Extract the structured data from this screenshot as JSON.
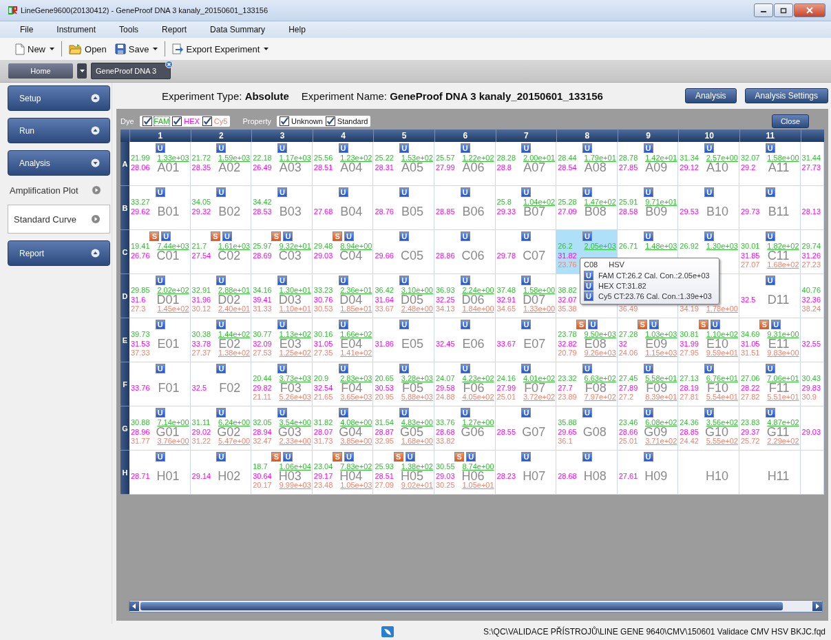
{
  "window": {
    "title": "LineGene9600(20130412) - GeneProof DNA 3 kanaly_20150601_133156"
  },
  "menu": [
    "File",
    "Instrument",
    "Tools",
    "Report",
    "Data Summary",
    "Help"
  ],
  "toolbar": [
    {
      "label": "New",
      "dropdown": true
    },
    {
      "label": "Open",
      "dropdown": false
    },
    {
      "label": "Save",
      "dropdown": true
    },
    {
      "label": "Export Experiment",
      "dropdown": true
    }
  ],
  "tabs": [
    {
      "label": "Home",
      "selected": false
    },
    {
      "label": "GeneProof DNA 3",
      "selected": true
    }
  ],
  "sidebar": [
    {
      "label": "Setup",
      "expanded": false
    },
    {
      "label": "Run",
      "expanded": false
    },
    {
      "label": "Analysis",
      "expanded": true,
      "items": [
        {
          "label": "Amplification Plot",
          "selected": false
        },
        {
          "label": "Standard Curve",
          "selected": true
        }
      ]
    },
    {
      "label": "Report",
      "expanded": false
    }
  ],
  "header": {
    "experiment_type": "Experiment Type: **Absolute**",
    "experiment_name": "Experiment Name: **GeneProof DNA 3 kanaly_20150601_133156**",
    "buttons": [
      "Analysis",
      "Analysis Settings"
    ]
  },
  "filters": {
    "dye_label": "Dye",
    "dyes": [
      {
        "label": "FAM",
        "checked": true,
        "color": "#22b022"
      },
      {
        "label": "HEX",
        "checked": true,
        "color": "#ff00ff"
      },
      {
        "label": "Cy5",
        "checked": true,
        "color": "#f4826c"
      }
    ],
    "property_label": "Property",
    "properties": [
      {
        "label": "Unknown",
        "checked": true
      },
      {
        "label": "Standard",
        "checked": true
      }
    ],
    "close": "Close"
  },
  "plate": {
    "columns": [
      "1",
      "2",
      "3",
      "4",
      "5",
      "6",
      "7",
      "8",
      "9",
      "10",
      "11"
    ],
    "rows": [
      {
        "label": "A",
        "cells": [
          {
            "well": "A01",
            "selected": false,
            "tags": [
              {
                "kind": "unknown",
                "text": "U"
              }
            ],
            "fam": [
              "21.99",
              "1.33e+03"
            ],
            "hex": "28.06"
          },
          {
            "well": "A02",
            "selected": false,
            "tags": [
              {
                "kind": "unknown",
                "text": "U"
              }
            ],
            "fam": [
              "21.72",
              "1.59e+03"
            ],
            "hex": "28.35"
          },
          {
            "well": "A03",
            "selected": false,
            "tags": [
              {
                "kind": "unknown",
                "text": "U"
              }
            ],
            "fam": [
              "22.18",
              "1.17e+03"
            ],
            "hex": "26.49"
          },
          {
            "well": "A04",
            "selected": false,
            "tags": [
              {
                "kind": "unknown",
                "text": "U"
              }
            ],
            "fam": [
              "25.56",
              "1.23e+02"
            ],
            "hex": "28.51"
          },
          {
            "well": "A05",
            "selected": false,
            "tags": [
              {
                "kind": "unknown",
                "text": "U"
              }
            ],
            "fam": [
              "25.22",
              "1.53e+02"
            ],
            "hex": "28.31"
          },
          {
            "well": "A06",
            "selected": false,
            "tags": [
              {
                "kind": "unknown",
                "text": "U"
              }
            ],
            "fam": [
              "25.57",
              "1.22e+02"
            ],
            "hex": "27.99"
          },
          {
            "well": "A07",
            "selected": false,
            "tags": [
              {
                "kind": "unknown",
                "text": "U"
              }
            ],
            "fam": [
              "28.28",
              "2.00e+01"
            ],
            "hex": "28.8"
          },
          {
            "well": "A08",
            "selected": false,
            "tags": [
              {
                "kind": "unknown",
                "text": "U"
              }
            ],
            "fam": [
              "28.44",
              "1.79e+01"
            ],
            "hex": "28.54"
          },
          {
            "well": "A09",
            "selected": false,
            "tags": [
              {
                "kind": "unknown",
                "text": "U"
              }
            ],
            "fam": [
              "28.78",
              "1.42e+01"
            ],
            "hex": "27.85"
          },
          {
            "well": "A10",
            "selected": false,
            "tags": [
              {
                "kind": "unknown",
                "text": "U"
              }
            ],
            "fam": [
              "31.34",
              "2.57e+00"
            ],
            "hex": "29.12"
          },
          {
            "well": "A11",
            "selected": false,
            "tags": [
              {
                "kind": "unknown",
                "text": "U"
              }
            ],
            "fam": [
              "32.07",
              "1.58e+00"
            ],
            "hex": "29.2"
          },
          {
            "selected": false,
            "fam": [
              "31.44"
            ],
            "hex": "27.73"
          }
        ]
      },
      {
        "label": "B",
        "cells": [
          {
            "well": "B01",
            "selected": false,
            "tags": [
              {
                "kind": "unknown",
                "text": "U"
              }
            ],
            "fam": [
              "33.27"
            ],
            "hex": "29.62"
          },
          {
            "well": "B02",
            "selected": false,
            "tags": [
              {
                "kind": "unknown",
                "text": "U"
              }
            ],
            "fam": [
              "34.05"
            ],
            "hex": "29.32"
          },
          {
            "well": "B03",
            "selected": false,
            "tags": [
              {
                "kind": "unknown",
                "text": "U"
              }
            ],
            "fam": [
              "34.42"
            ],
            "hex": "28.53"
          },
          {
            "well": "B04",
            "selected": false,
            "tags": [
              {
                "kind": "unknown",
                "text": "U"
              }
            ],
            "hex": "27.68"
          },
          {
            "well": "B05",
            "selected": false,
            "tags": [
              {
                "kind": "unknown",
                "text": "U"
              }
            ],
            "hex": "28.76"
          },
          {
            "well": "B06",
            "selected": false,
            "tags": [
              {
                "kind": "unknown",
                "text": "U"
              }
            ],
            "hex": "28.85"
          },
          {
            "well": "B07",
            "selected": false,
            "tags": [
              {
                "kind": "unknown",
                "text": "U"
              }
            ],
            "fam": [
              "25.8",
              "1.04e+02"
            ],
            "hex": "29.33"
          },
          {
            "well": "B08",
            "selected": false,
            "tags": [
              {
                "kind": "unknown",
                "text": "U"
              }
            ],
            "fam": [
              "25.28",
              "1.47e+02"
            ],
            "hex": "27.09"
          },
          {
            "well": "B09",
            "selected": false,
            "tags": [
              {
                "kind": "unknown",
                "text": "U"
              }
            ],
            "fam": [
              "25.91",
              "9.71e+01"
            ],
            "hex": "28.58"
          },
          {
            "well": "B10",
            "selected": false,
            "tags": [
              {
                "kind": "unknown",
                "text": "U"
              }
            ],
            "hex": "29.53"
          },
          {
            "well": "B11",
            "selected": false,
            "tags": [
              {
                "kind": "unknown",
                "text": "U"
              }
            ],
            "hex": "29.73"
          },
          {
            "selected": false,
            "hex": "28.13"
          }
        ]
      },
      {
        "label": "C",
        "cells": [
          {
            "well": "C01",
            "selected": false,
            "tags": [
              {
                "kind": "standard",
                "text": "S"
              },
              {
                "kind": "unknown",
                "text": "U"
              }
            ],
            "fam": [
              "19.41",
              "7.44e+03"
            ],
            "hex": "26.76"
          },
          {
            "well": "C02",
            "selected": false,
            "tags": [
              {
                "kind": "standard",
                "text": "S"
              },
              {
                "kind": "unknown",
                "text": "U"
              }
            ],
            "fam": [
              "21.7",
              "1.61e+03"
            ],
            "hex": "27.54"
          },
          {
            "well": "C03",
            "selected": false,
            "tags": [
              {
                "kind": "standard",
                "text": "S"
              },
              {
                "kind": "unknown",
                "text": "U"
              }
            ],
            "fam": [
              "25.97",
              "9.32e+01"
            ],
            "hex": "28.69"
          },
          {
            "well": "C04",
            "selected": false,
            "tags": [
              {
                "kind": "standard",
                "text": "S"
              },
              {
                "kind": "unknown",
                "text": "U"
              }
            ],
            "fam": [
              "29.48",
              "8.94e+00"
            ],
            "hex": "29.03"
          },
          {
            "well": "C05",
            "selected": false,
            "tags": [
              {
                "kind": "unknown",
                "text": "U"
              }
            ],
            "hex": "29.66"
          },
          {
            "well": "C06",
            "selected": false,
            "tags": [
              {
                "kind": "unknown",
                "text": "U"
              }
            ],
            "hex": "28.86"
          },
          {
            "well": "C07",
            "selected": false,
            "tags": [
              {
                "kind": "unknown",
                "text": "U"
              }
            ],
            "hex": "29.78"
          },
          {
            "selected": true,
            "tags": [
              {
                "kind": "unknown",
                "text": "U"
              }
            ],
            "fam": [
              "26.2",
              "2.05e+03"
            ],
            "hex": "31.82",
            "cy5": [
              "23.76"
            ]
          },
          {
            "selected": false,
            "tags": [
              {
                "kind": "unknown",
                "text": "U"
              }
            ],
            "fam": [
              "26.71",
              "1.48e+03"
            ]
          },
          {
            "selected": false,
            "tags": [
              {
                "kind": "unknown",
                "text": "U"
              }
            ],
            "fam": [
              "26.92",
              "1.30e+03"
            ]
          },
          {
            "well": "C11",
            "selected": false,
            "tags": [
              {
                "kind": "unknown",
                "text": "U"
              }
            ],
            "fam": [
              "30.01",
              "1.82e+02"
            ],
            "hex": "31.85",
            "cy5": [
              "27.07",
              "1.68e+02"
            ]
          },
          {
            "selected": false,
            "fam": [
              "29.74"
            ],
            "hex": "31.26",
            "cy5": [
              "27.23"
            ]
          }
        ]
      },
      {
        "label": "D",
        "cells": [
          {
            "well": "D01",
            "selected": false,
            "tags": [
              {
                "kind": "unknown",
                "text": "U"
              }
            ],
            "fam": [
              "29.85",
              "2.02e+02"
            ],
            "hex": "31.6",
            "cy5": [
              "27.3",
              "1.45e+02"
            ]
          },
          {
            "well": "D02",
            "selected": false,
            "tags": [
              {
                "kind": "unknown",
                "text": "U"
              }
            ],
            "fam": [
              "32.91",
              "2.88e+01"
            ],
            "hex": "31.96",
            "cy5": [
              "30.12",
              "2.40e+01"
            ]
          },
          {
            "well": "D03",
            "selected": false,
            "tags": [
              {
                "kind": "unknown",
                "text": "U"
              }
            ],
            "fam": [
              "34.16",
              "1.30e+01"
            ],
            "hex": "39.41",
            "cy5": [
              "31.33",
              "1.10e+01"
            ]
          },
          {
            "well": "D04",
            "selected": false,
            "tags": [
              {
                "kind": "unknown",
                "text": "U"
              }
            ],
            "fam": [
              "33.23",
              "2.36e+01"
            ],
            "hex": "30.76",
            "cy5": [
              "30.53",
              "1.85e+01"
            ]
          },
          {
            "well": "D05",
            "selected": false,
            "tags": [
              {
                "kind": "unknown",
                "text": "U"
              }
            ],
            "fam": [
              "36.42",
              "3.10e+00"
            ],
            "hex": "31.64",
            "cy5": [
              "33.67",
              "2.48e+00"
            ]
          },
          {
            "well": "D06",
            "selected": false,
            "tags": [
              {
                "kind": "unknown",
                "text": "U"
              }
            ],
            "fam": [
              "36.93",
              "2.24e+00"
            ],
            "hex": "32.25",
            "cy5": [
              "34.13",
              "1.84e+00"
            ]
          },
          {
            "well": "D07",
            "selected": false,
            "tags": [
              {
                "kind": "unknown",
                "text": "U"
              }
            ],
            "fam": [
              "37.48",
              "1.58e+00"
            ],
            "hex": "32.91",
            "cy5": [
              "34.65",
              "1.33e+00"
            ]
          },
          {
            "selected": false,
            "fam": [
              "38.82"
            ],
            "hex": "32.07",
            "cy5": [
              "35.38"
            ]
          },
          {
            "selected": false,
            "cy5": [
              "36.49"
            ]
          },
          {
            "selected": false,
            "cy5": [
              "34.19",
              "1.78e+00"
            ]
          },
          {
            "well": "D11",
            "selected": false,
            "tags": [
              {
                "kind": "unknown",
                "text": "U"
              }
            ],
            "hex": "32.5"
          },
          {
            "selected": false,
            "fam": [
              "40.76"
            ],
            "hex": "32.36",
            "cy5": [
              "38.24"
            ]
          }
        ]
      },
      {
        "label": "E",
        "cells": [
          {
            "well": "E01",
            "selected": false,
            "tags": [
              {
                "kind": "unknown",
                "text": "U"
              }
            ],
            "fam": [
              "39.73"
            ],
            "hex": "31.53",
            "cy5": [
              "37.33"
            ]
          },
          {
            "well": "E02",
            "selected": false,
            "tags": [
              {
                "kind": "unknown",
                "text": "U"
              }
            ],
            "fam": [
              "30.38",
              "1.44e+02"
            ],
            "hex": "33.78",
            "cy5": [
              "27.37",
              "1.38e+02"
            ]
          },
          {
            "well": "E03",
            "selected": false,
            "tags": [
              {
                "kind": "unknown",
                "text": "U"
              }
            ],
            "fam": [
              "30.77",
              "1.13e+02"
            ],
            "hex": "32.09",
            "cy5": [
              "27.53",
              "1.25e+02"
            ]
          },
          {
            "well": "E04",
            "selected": false,
            "tags": [
              {
                "kind": "unknown",
                "text": "U"
              }
            ],
            "fam": [
              "30.16",
              "1.66e+02"
            ],
            "hex": "31.05",
            "cy5": [
              "27.35",
              "1.41e+02"
            ]
          },
          {
            "well": "E05",
            "selected": false,
            "tags": [
              {
                "kind": "unknown",
                "text": "U"
              }
            ],
            "hex": "31.86"
          },
          {
            "well": "E06",
            "selected": false,
            "tags": [
              {
                "kind": "unknown",
                "text": "U"
              }
            ],
            "hex": "32.45"
          },
          {
            "well": "E07",
            "selected": false,
            "tags": [
              {
                "kind": "unknown",
                "text": "U"
              }
            ],
            "hex": "33.67"
          },
          {
            "well": "E08",
            "selected": false,
            "tags": [
              {
                "kind": "standard",
                "text": "S"
              },
              {
                "kind": "unknown",
                "text": "U"
              }
            ],
            "fam": [
              "23.78",
              "9.50e+03"
            ],
            "hex": "32.82",
            "cy5": [
              "20.79",
              "9.26e+03"
            ]
          },
          {
            "well": "E09",
            "selected": false,
            "tags": [
              {
                "kind": "standard",
                "text": "S"
              },
              {
                "kind": "unknown",
                "text": "U"
              }
            ],
            "fam": [
              "27.28",
              "1.03e+03"
            ],
            "hex": "32",
            "cy5": [
              "24.06",
              "1.15e+03"
            ]
          },
          {
            "well": "E10",
            "selected": false,
            "tags": [
              {
                "kind": "standard",
                "text": "S"
              },
              {
                "kind": "unknown",
                "text": "U"
              }
            ],
            "fam": [
              "30.81",
              "1.10e+02"
            ],
            "hex": "31.99",
            "cy5": [
              "27.95",
              "9.59e+01"
            ]
          },
          {
            "well": "E11",
            "selected": false,
            "tags": [
              {
                "kind": "standard",
                "text": "S"
              },
              {
                "kind": "unknown",
                "text": "U"
              }
            ],
            "fam": [
              "34.69",
              "9.31e+00"
            ],
            "hex": "31.05",
            "cy5": [
              "31.51",
              "9.83e+00"
            ]
          },
          {
            "selected": false,
            "hex": "32.55"
          }
        ]
      },
      {
        "label": "F",
        "cells": [
          {
            "well": "F01",
            "selected": false,
            "tags": [
              {
                "kind": "unknown",
                "text": "U"
              }
            ],
            "hex": "33.76"
          },
          {
            "well": "F02",
            "selected": false,
            "tags": [
              {
                "kind": "unknown",
                "text": "U"
              }
            ],
            "hex": "32.5"
          },
          {
            "well": "F03",
            "selected": false,
            "tags": [
              {
                "kind": "unknown",
                "text": "U"
              }
            ],
            "fam": [
              "20.44",
              "3.73e+03"
            ],
            "hex": "29.82",
            "cy5": [
              "21.11",
              "5.26e+03"
            ]
          },
          {
            "well": "F04",
            "selected": false,
            "tags": [
              {
                "kind": "unknown",
                "text": "U"
              }
            ],
            "fam": [
              "20.9",
              "2.83e+03"
            ],
            "hex": "32.54",
            "cy5": [
              "21.65",
              "3.65e+03"
            ]
          },
          {
            "well": "F05",
            "selected": false,
            "tags": [
              {
                "kind": "unknown",
                "text": "U"
              }
            ],
            "fam": [
              "20.65",
              "3.28e+03"
            ],
            "hex": "30.53",
            "cy5": [
              "20.95",
              "5.88e+03"
            ]
          },
          {
            "well": "F06",
            "selected": false,
            "tags": [
              {
                "kind": "unknown",
                "text": "U"
              }
            ],
            "fam": [
              "24.07",
              "4.23e+02"
            ],
            "hex": "29.58",
            "cy5": [
              "24.88",
              "4.05e+02"
            ]
          },
          {
            "well": "F07",
            "selected": false,
            "tags": [
              {
                "kind": "unknown",
                "text": "U"
              }
            ],
            "fam": [
              "24.16",
              "4.01e+02"
            ],
            "hex": "27.99",
            "cy5": [
              "25.01",
              "3.72e+02"
            ]
          },
          {
            "well": "F08",
            "selected": false,
            "tags": [
              {
                "kind": "unknown",
                "text": "U"
              }
            ],
            "fam": [
              "23.32",
              "6.63e+02"
            ],
            "hex": "27.7",
            "cy5": [
              "23.89",
              "7.97e+02"
            ]
          },
          {
            "well": "F09",
            "selected": false,
            "tags": [
              {
                "kind": "unknown",
                "text": "U"
              }
            ],
            "fam": [
              "27.45",
              "5.58e+01"
            ],
            "hex": "27.89",
            "cy5": [
              "27.2",
              "8.39e+01"
            ]
          },
          {
            "well": "F10",
            "selected": false,
            "tags": [
              {
                "kind": "unknown",
                "text": "U"
              }
            ],
            "fam": [
              "27.13",
              "6.76e+01"
            ],
            "hex": "28.19",
            "cy5": [
              "27.81",
              "5.54e+01"
            ]
          },
          {
            "well": "F11",
            "selected": false,
            "tags": [
              {
                "kind": "unknown",
                "text": "U"
              }
            ],
            "fam": [
              "27.06",
              "7.06e+01"
            ],
            "hex": "28.22",
            "cy5": [
              "27.82",
              "5.51e+01"
            ]
          },
          {
            "selected": false,
            "fam": [
              "30.43"
            ],
            "hex": "29.83",
            "cy5": [
              "30.9"
            ]
          }
        ]
      },
      {
        "label": "G",
        "cells": [
          {
            "well": "G01",
            "selected": false,
            "tags": [
              {
                "kind": "unknown",
                "text": "U"
              }
            ],
            "fam": [
              "30.88",
              "7.14e+00"
            ],
            "hex": "28.96",
            "cy5": [
              "31.77",
              "3.76e+00"
            ]
          },
          {
            "well": "G02",
            "selected": false,
            "tags": [
              {
                "kind": "unknown",
                "text": "U"
              }
            ],
            "fam": [
              "31.11",
              "6.24e+00"
            ],
            "hex": "29.02",
            "cy5": [
              "31.22",
              "5.47e+00"
            ]
          },
          {
            "well": "G03",
            "selected": false,
            "tags": [
              {
                "kind": "unknown",
                "text": "U"
              }
            ],
            "fam": [
              "32.05",
              "3.54e+00"
            ],
            "hex": "28.94",
            "cy5": [
              "32.47",
              "2.33e+00"
            ]
          },
          {
            "well": "G04",
            "selected": false,
            "tags": [
              {
                "kind": "unknown",
                "text": "U"
              }
            ],
            "fam": [
              "31.82",
              "4.08e+00"
            ],
            "hex": "28.07",
            "cy5": [
              "31.73",
              "3.85e+00"
            ]
          },
          {
            "well": "G05",
            "selected": false,
            "tags": [
              {
                "kind": "unknown",
                "text": "U"
              }
            ],
            "fam": [
              "31.54",
              "4.83e+00"
            ],
            "hex": "28.87",
            "cy5": [
              "32.95",
              "1.68e+00"
            ]
          },
          {
            "well": "G06",
            "selected": false,
            "tags": [
              {
                "kind": "unknown",
                "text": "U"
              }
            ],
            "fam": [
              "33.76",
              "1.27e+00"
            ],
            "hex": "28.68",
            "cy5": [
              "33.82"
            ]
          },
          {
            "well": "G07",
            "selected": false,
            "tags": [
              {
                "kind": "unknown",
                "text": "U"
              }
            ],
            "hex": "28.55"
          },
          {
            "well": "G08",
            "selected": false,
            "tags": [
              {
                "kind": "unknown",
                "text": "U"
              }
            ],
            "fam": [
              "35.88"
            ],
            "hex": "29.65",
            "cy5": [
              "36.1"
            ]
          },
          {
            "well": "G09",
            "selected": false,
            "tags": [
              {
                "kind": "unknown",
                "text": "U"
              }
            ],
            "fam": [
              "23.46",
              "6.08e+02"
            ],
            "hex": "28.66",
            "cy5": [
              "25.01",
              "3.71e+02"
            ]
          },
          {
            "well": "G10",
            "selected": false,
            "tags": [
              {
                "kind": "unknown",
                "text": "U"
              }
            ],
            "fam": [
              "24.36",
              "3.56e+02"
            ],
            "hex": "28.85",
            "cy5": [
              "24.42",
              "5.55e+02"
            ]
          },
          {
            "well": "G11",
            "selected": false,
            "tags": [
              {
                "kind": "unknown",
                "text": "U"
              }
            ],
            "fam": [
              "23.83",
              "4.87e+02"
            ],
            "hex": "29.37",
            "cy5": [
              "25.72",
              "2.29e+02"
            ]
          },
          {
            "selected": false,
            "hex": "29.03"
          }
        ]
      },
      {
        "label": "H",
        "cells": [
          {
            "well": "H01",
            "selected": false,
            "tags": [
              {
                "kind": "unknown",
                "text": "U"
              }
            ],
            "hex": "28.71"
          },
          {
            "well": "H02",
            "selected": false,
            "tags": [
              {
                "kind": "unknown",
                "text": "U"
              }
            ],
            "hex": "29.14"
          },
          {
            "well": "H03",
            "selected": false,
            "tags": [
              {
                "kind": "standard",
                "text": "S"
              },
              {
                "kind": "unknown",
                "text": "U"
              }
            ],
            "fam": [
              "18.7",
              "1.06e+04"
            ],
            "hex": "30.64",
            "cy5": [
              "20.17",
              "9.99e+03"
            ]
          },
          {
            "well": "H04",
            "selected": false,
            "tags": [
              {
                "kind": "standard",
                "text": "S"
              },
              {
                "kind": "unknown",
                "text": "U"
              }
            ],
            "fam": [
              "23.04",
              "7.83e+02"
            ],
            "hex": "29.17",
            "cy5": [
              "23.48",
              "1.05e+03"
            ]
          },
          {
            "well": "H05",
            "selected": false,
            "tags": [
              {
                "kind": "standard",
                "text": "S"
              },
              {
                "kind": "unknown",
                "text": "U"
              }
            ],
            "fam": [
              "25.93",
              "1.38e+02"
            ],
            "hex": "28.51",
            "cy5": [
              "27.09",
              "9.02e+01"
            ]
          },
          {
            "well": "H06",
            "selected": false,
            "tags": [
              {
                "kind": "standard",
                "text": "S"
              },
              {
                "kind": "unknown",
                "text": "U"
              }
            ],
            "fam": [
              "30.55",
              "8.74e+00"
            ],
            "hex": "29.03",
            "cy5": [
              "30.25",
              "1.05e+01"
            ]
          },
          {
            "well": "H07",
            "selected": false,
            "tags": [
              {
                "kind": "unknown",
                "text": "U"
              }
            ],
            "hex": "28.23"
          },
          {
            "well": "H08",
            "selected": false,
            "tags": [
              {
                "kind": "unknown",
                "text": "U"
              }
            ],
            "hex": "28.68"
          },
          {
            "well": "H09",
            "selected": false,
            "tags": [
              {
                "kind": "unknown",
                "text": "U"
              }
            ],
            "hex": "27.61"
          },
          {
            "well": "H10",
            "selected": false
          },
          {
            "well": "H11",
            "selected": false
          },
          {
            "selected": false
          }
        ]
      }
    ]
  },
  "tooltip": {
    "well": "C08",
    "sample": "HSV",
    "lines": [
      {
        "tag": "U",
        "text": "FAM CT:26.2 Cal. Con.:2.05e+03"
      },
      {
        "tag": "U",
        "text": "HEX CT:31.82"
      },
      {
        "tag": "U",
        "text": "Cy5 CT:23.76 Cal. Con.:1.39e+03"
      }
    ]
  },
  "status_bar": {
    "path": "S:\\QC\\VALIDACE PŘÍSTROJŮ\\LINE GENE 9640\\CMV\\150601 Validace CMV HSV BKJC.fqd"
  }
}
